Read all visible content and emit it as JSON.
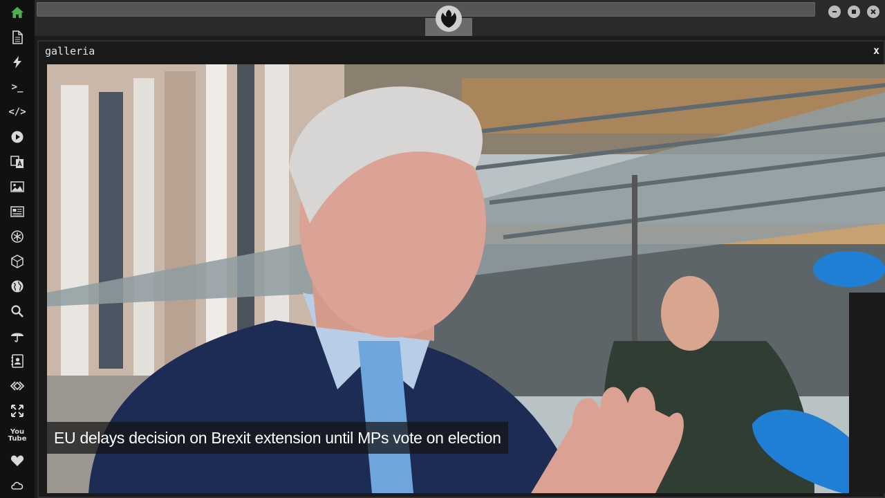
{
  "panel": {
    "title": "galleria",
    "close_label": "x"
  },
  "gallery": {
    "caption": "EU delays decision on Brexit extension until MPs vote on election"
  },
  "sidebar": {
    "items": [
      {
        "icon": "home-icon"
      },
      {
        "icon": "document-icon"
      },
      {
        "icon": "lightning-icon"
      },
      {
        "icon": "terminal-icon",
        "text": ">_"
      },
      {
        "icon": "code-icon",
        "text": "</>"
      },
      {
        "icon": "play-icon"
      },
      {
        "icon": "translate-icon"
      },
      {
        "icon": "image-icon"
      },
      {
        "icon": "newspaper-icon"
      },
      {
        "icon": "rebel-icon"
      },
      {
        "icon": "cube-icon"
      },
      {
        "icon": "globe-icon"
      },
      {
        "icon": "search-icon"
      },
      {
        "icon": "umbrella-icon"
      },
      {
        "icon": "contacts-icon"
      },
      {
        "icon": "tags-icon"
      },
      {
        "icon": "expand-icon"
      },
      {
        "icon": "youtube-icon",
        "text": "You Tube"
      },
      {
        "icon": "heart-icon"
      },
      {
        "icon": "cloud-icon"
      }
    ]
  },
  "colors": {
    "home_accent": "#4caf50",
    "sidebar_bg": "#111111",
    "topbar_bg": "#2a2a2a"
  }
}
